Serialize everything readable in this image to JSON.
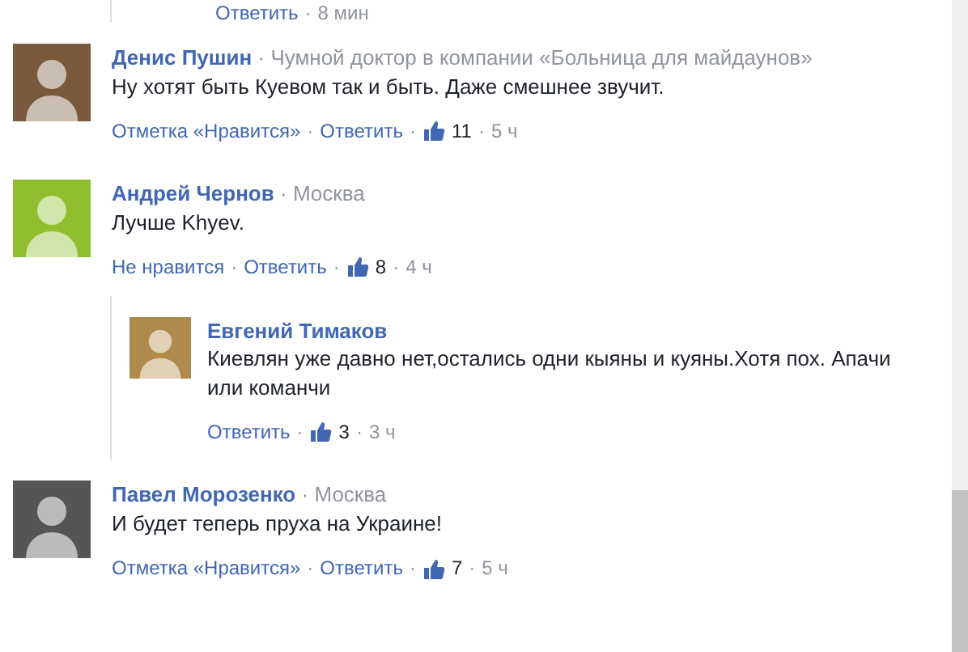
{
  "separator": "·",
  "top_partial": {
    "reply": "Ответить",
    "time": "8 мин"
  },
  "comments": [
    {
      "author": "Денис Пушин",
      "meta": "Чумной доктор в компании «Больница для майдаунов»",
      "text": "Ну хотят быть Куевом так и быть. Даже смешнее звучит.",
      "like_link": "Отметка «Нравится»",
      "reply": "Ответить",
      "likes": "11",
      "time": "5 ч"
    },
    {
      "author": "Андрей Чернов",
      "meta": "Москва",
      "text": "Лучше Khyev.",
      "like_link": "Не нравится",
      "reply": "Ответить",
      "likes": "8",
      "time": "4 ч",
      "replies": [
        {
          "author": "Евгений Тимаков",
          "text": "Киевлян уже давно нет,остались одни кыяны и куяны.Хотя пох. Апачи или команчи",
          "reply": "Ответить",
          "likes": "3",
          "time": "3 ч"
        }
      ]
    },
    {
      "author": "Павел Морозенко",
      "meta": "Москва",
      "text": "И будет теперь пруха на Украине!",
      "like_link": "Отметка «Нравится»",
      "reply": "Ответить",
      "likes": "7",
      "time": "5 ч"
    }
  ]
}
